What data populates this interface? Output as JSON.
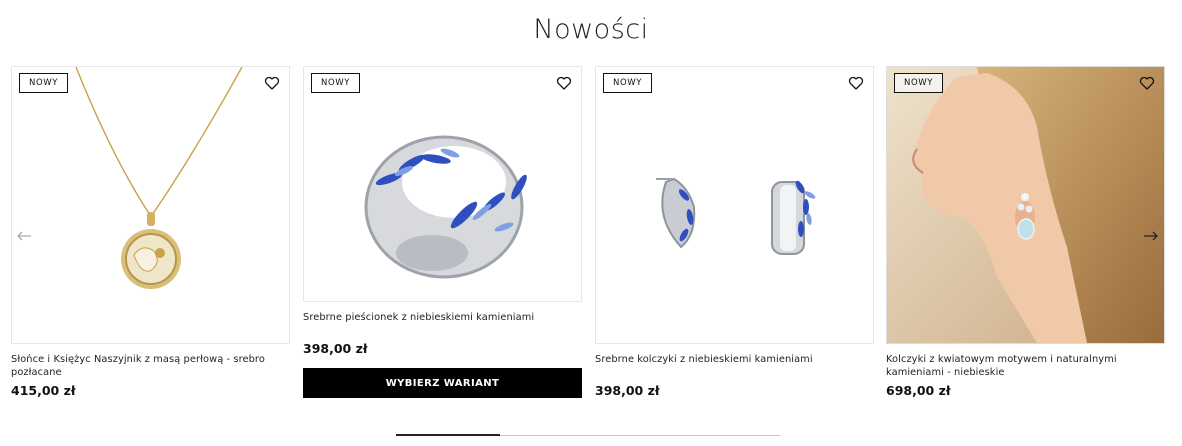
{
  "section_title": "Nowości",
  "products": [
    {
      "badge": "NOWY",
      "name": "Słońce i Księżyc Naszyjnik z masą perłową - srebro pozłacane",
      "price": "415,00 zł"
    },
    {
      "badge": "NOWY",
      "name": "Srebrne pieścionek z niebieskiemi kamieniami",
      "price": "398,00 zł",
      "button": "WYBIERZ WARIANT"
    },
    {
      "badge": "NOWY",
      "name": "Srebrne kolczyki z niebieskiemi kamieniami",
      "price": "398,00 zł"
    },
    {
      "badge": "NOWY",
      "name": "Kolczyki z kwiatowym motywem i naturalnymi kamieniami - niebieskie",
      "price": "698,00 zł"
    }
  ],
  "carousel": {
    "progress": 0.27
  },
  "colors": {
    "accent": "#000000",
    "badge_border": "#111111",
    "stone_blue": "#2f4fbf"
  },
  "icons": {
    "wishlist": "heart-icon",
    "prev": "arrow-left-icon",
    "next": "arrow-right-icon"
  }
}
